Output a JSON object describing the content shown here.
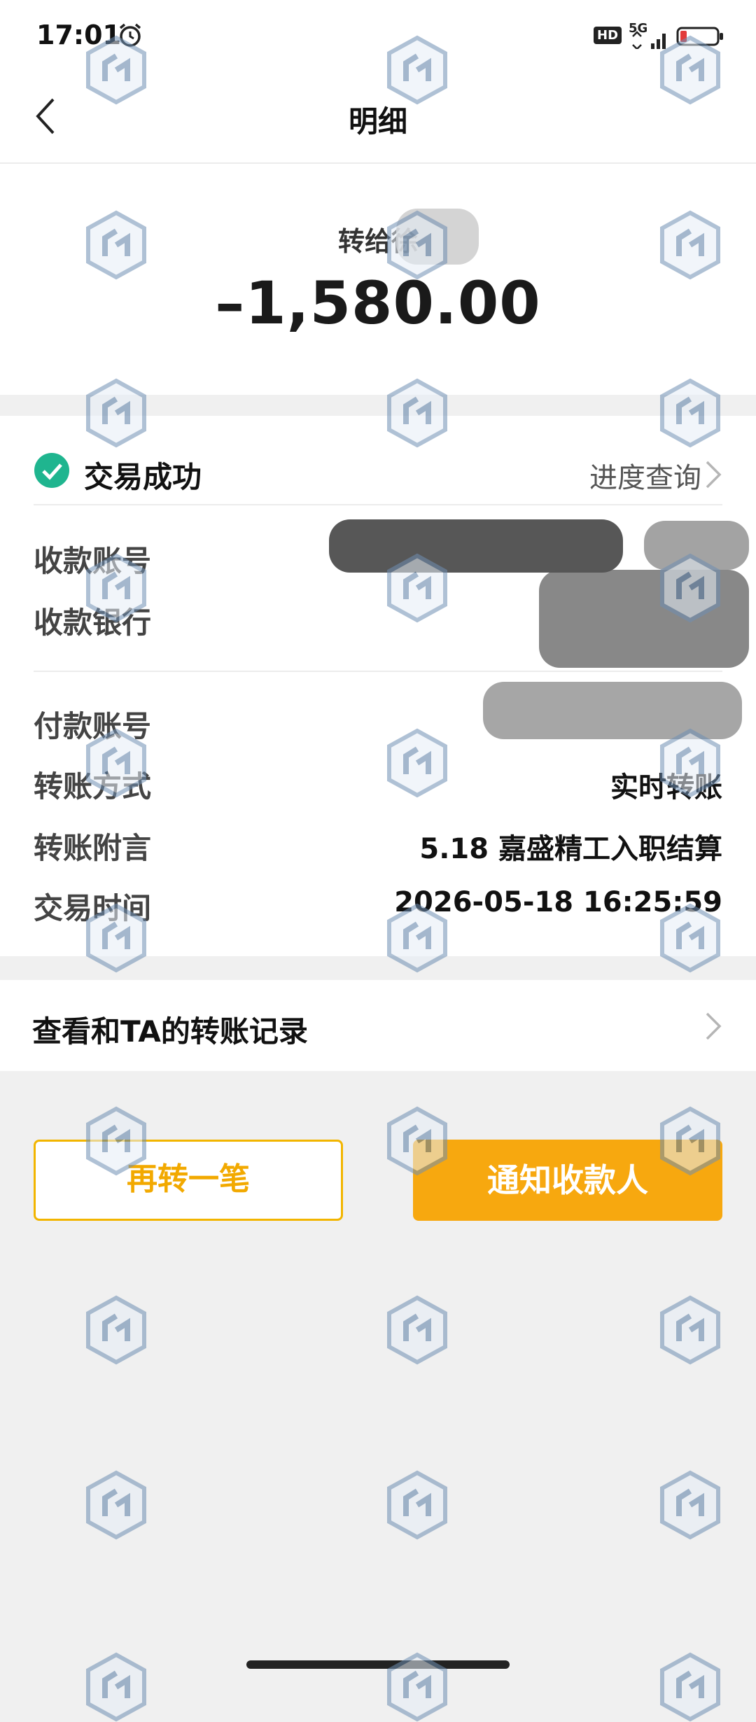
{
  "status_bar": {
    "time": "17:01",
    "hd_badge": "HD",
    "network": "5G",
    "alarm_icon": "alarm-clock-icon",
    "battery_icon": "battery-low-icon"
  },
  "nav": {
    "title": "明细",
    "back_icon": "chevron-left-icon"
  },
  "transfer": {
    "payee_label": "转给徐",
    "amount": "–1,580.00"
  },
  "status": {
    "text": "交易成功",
    "progress_link": "进度查询",
    "icon": "check-circle-icon",
    "color": "#1fb58f"
  },
  "fields": {
    "payee_account_label": "收款账号",
    "payee_bank_label": "收款银行",
    "payer_account_label": "付款账号",
    "method_label": "转账方式",
    "method_value": "实时转账",
    "memo_label": "转账附言",
    "memo_value": "5.18 嘉盛精工入职结算",
    "time_label": "交易时间",
    "time_value": "2026-05-18 16:25:59"
  },
  "records": {
    "label": "查看和TA的转账记录"
  },
  "actions": {
    "transfer_again": "再转一笔",
    "notify_payee": "通知收款人",
    "accent_color": "#f7a80f"
  }
}
